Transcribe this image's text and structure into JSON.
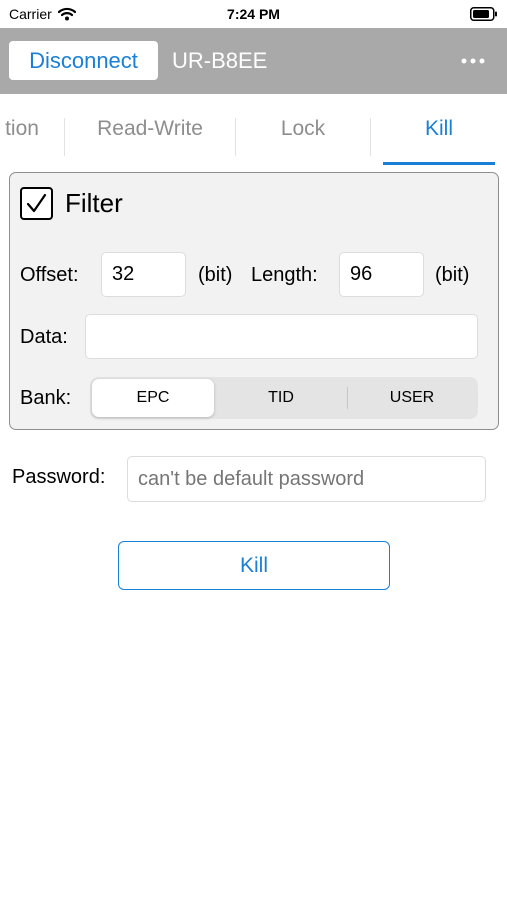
{
  "status_bar": {
    "carrier": "Carrier",
    "time": "7:24 PM",
    "icons": [
      "wifi-icon",
      "battery-icon"
    ]
  },
  "nav_bar": {
    "disconnect_label": "Disconnect",
    "device_name": "UR-B8EE",
    "more_icon": "ellipsis-icon"
  },
  "tabs": [
    {
      "label": "tion",
      "active": false
    },
    {
      "label": "Read-Write",
      "active": false
    },
    {
      "label": "Lock",
      "active": false
    },
    {
      "label": "Kill",
      "active": true
    }
  ],
  "filter": {
    "checked": true,
    "label": "Filter",
    "offset_label": "Offset:",
    "offset_value": "32",
    "offset_unit": "(bit)",
    "length_label": "Length:",
    "length_value": "96",
    "length_unit": "(bit)",
    "data_label": "Data:",
    "data_value": "",
    "bank_label": "Bank:",
    "bank_options": [
      "EPC",
      "TID",
      "USER"
    ],
    "bank_selected": "EPC"
  },
  "password": {
    "label": "Password:",
    "value": "",
    "placeholder": "can't be default password"
  },
  "kill_button_label": "Kill",
  "colors": {
    "accent": "#1a7fd6",
    "nav_background": "#a9a9a9",
    "panel_background": "#f2f2f2"
  }
}
